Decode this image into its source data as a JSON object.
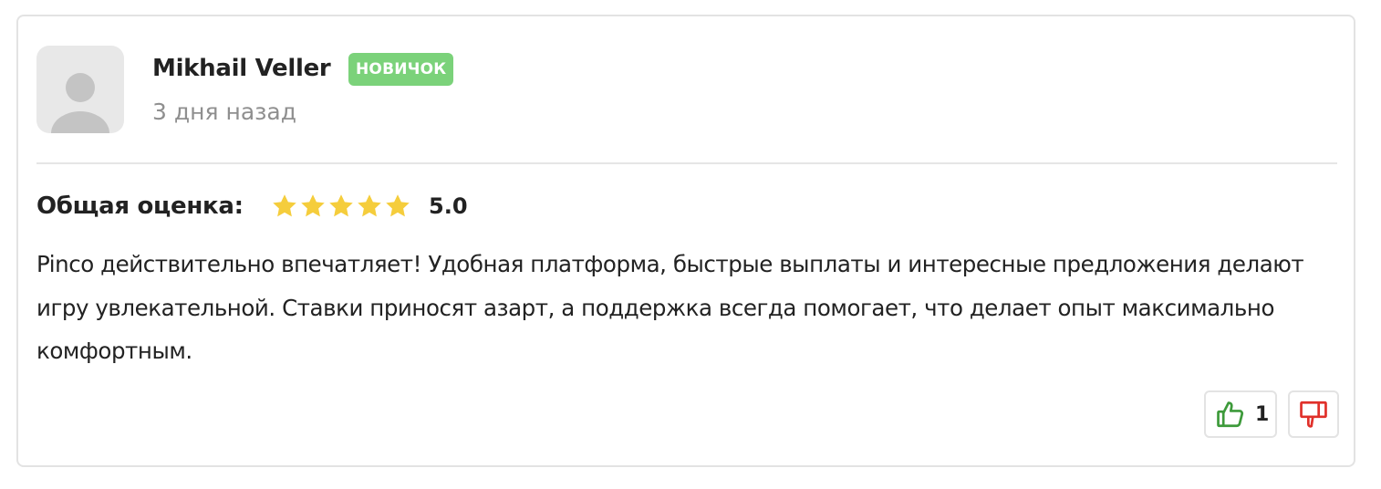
{
  "review": {
    "author": {
      "name": "Mikhail Veller",
      "badge": "НОВИЧОК",
      "date": "3 дня назад",
      "avatar_icon": "user-avatar-placeholder-icon"
    },
    "rating": {
      "label": "Общая оценка:",
      "stars_filled": 5,
      "stars_total": 5,
      "value": "5.0"
    },
    "text": "Pinco действительно впечатляет! Удобная платформа, быстрые выплаты и интересные предложения делают игру увлекательной. Ставки приносят азарт, а поддержка всегда помогает, что делает опыт максимально комфортным.",
    "votes": {
      "like_icon": "thumbs-up-icon",
      "like_count": "1",
      "dislike_icon": "thumbs-down-icon"
    }
  },
  "colors": {
    "badge_bg": "#7bd27a",
    "star": "#f5cd3c",
    "like": "#3d9a3a",
    "dislike": "#e0302a",
    "muted_text": "#8f8f8f"
  }
}
